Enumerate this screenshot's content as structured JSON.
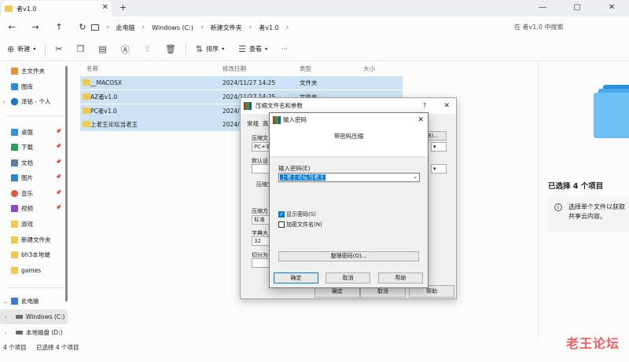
{
  "tab": {
    "title": "者v1.0",
    "close": "✕",
    "new_tab": "+"
  },
  "window_controls": [
    "—",
    "▢",
    "✕"
  ],
  "nav": {
    "back": "←",
    "forward": "→",
    "up": "↑",
    "refresh": "↻"
  },
  "breadcrumb": [
    "此电脑",
    "Windows (C:)",
    "新建文件夹",
    "者v1.0"
  ],
  "search": {
    "placeholder": "在 者v1.0 中搜索"
  },
  "toolbar": {
    "new_label": "新建",
    "sort_label": "排序",
    "view_label": "查看",
    "more_label": "···"
  },
  "sidebar": {
    "top": [
      {
        "label": "主文件夹",
        "icon": "home-icon",
        "color": "#e3953b"
      },
      {
        "label": "图库",
        "icon": "gallery-icon",
        "color": "#2e8bd6"
      },
      {
        "label": "泽铭 - 个人",
        "icon": "cloud-icon",
        "color": "#1a73c8"
      }
    ],
    "pinned": [
      {
        "label": "桌面",
        "icon": "desktop-icon",
        "color": "#3a8fd8"
      },
      {
        "label": "下载",
        "icon": "download-icon",
        "color": "#2a9d5a"
      },
      {
        "label": "文档",
        "icon": "document-icon",
        "color": "#5f7da0"
      },
      {
        "label": "图片",
        "icon": "pictures-icon",
        "color": "#2f83c9"
      },
      {
        "label": "音乐",
        "icon": "music-icon",
        "color": "#e0583a"
      },
      {
        "label": "视频",
        "icon": "video-icon",
        "color": "#8a4bc6"
      },
      {
        "label": "游戏",
        "icon": "folder-icon",
        "color": "#f2c94c"
      },
      {
        "label": "新建文件夹",
        "icon": "folder-icon",
        "color": "#f2c94c"
      },
      {
        "label": "bh3本地端",
        "icon": "folder-icon",
        "color": "#f2c94c"
      },
      {
        "label": "games",
        "icon": "folder-icon",
        "color": "#f2c94c"
      }
    ],
    "devices": [
      {
        "label": "此电脑",
        "icon": "pc-icon",
        "color": "#3a7bd5"
      },
      {
        "label": "Windows (C:)",
        "icon": "drive-icon",
        "color": "#6b6b6b"
      },
      {
        "label": "本地磁盘 (D:)",
        "icon": "drive-icon",
        "color": "#6b6b6b"
      }
    ]
  },
  "columns": {
    "name": "名称",
    "date": "修改日期",
    "type": "类型",
    "size": "大小"
  },
  "files": [
    {
      "name": "__MACOSX",
      "date": "2024/11/27 14:25",
      "type": "文件夹"
    },
    {
      "name": "AZ者v1.0",
      "date": "2024/11/27 14:25",
      "type": "文件夹"
    },
    {
      "name": "PC者v1.0",
      "date": "2024/1",
      "type": ""
    },
    {
      "name": "上老王论坛当老王",
      "date": "2024/",
      "type": ""
    }
  ],
  "details": {
    "title": "已选择 4 个项目",
    "info_line1": "选择单个文件以获取",
    "info_line2": "共享云内容。"
  },
  "status": {
    "count": "4 个项目",
    "selected": "已选择 4 个项目"
  },
  "watermark": "老王论坛",
  "archive_dialog": {
    "title": "压缩文件名和参数",
    "help": "?",
    "close": "✕",
    "tabs": [
      "常规",
      "高"
    ],
    "archive_name_label": "压缩文",
    "archive_name_value": "PC+安",
    "browse_button": "(B)...",
    "profile_label": "默认设",
    "format_label": "压缩文",
    "method_label": "压缩方",
    "method_value": "标准",
    "dict_label": "字典大",
    "dict_value": "32",
    "split_label": "切分为",
    "ok": "确定",
    "cancel": "取消",
    "help_button": "帮助"
  },
  "password_dialog": {
    "title": "输入密码",
    "close": "✕",
    "header": "带密码压缩",
    "input_label": "输入密码(E)",
    "input_value": "上老王论坛当老王",
    "show_password": {
      "label": "显示密码(S)",
      "checked": true
    },
    "encrypt_names": {
      "label": "加密文件名(N)",
      "checked": false
    },
    "manage_button": "整理密码(O)...",
    "ok": "确定",
    "cancel": "取消",
    "help": "帮助"
  },
  "colors": {
    "selection": "#cce3f5",
    "accent": "#0078d7",
    "folder": "#f2c94c"
  }
}
